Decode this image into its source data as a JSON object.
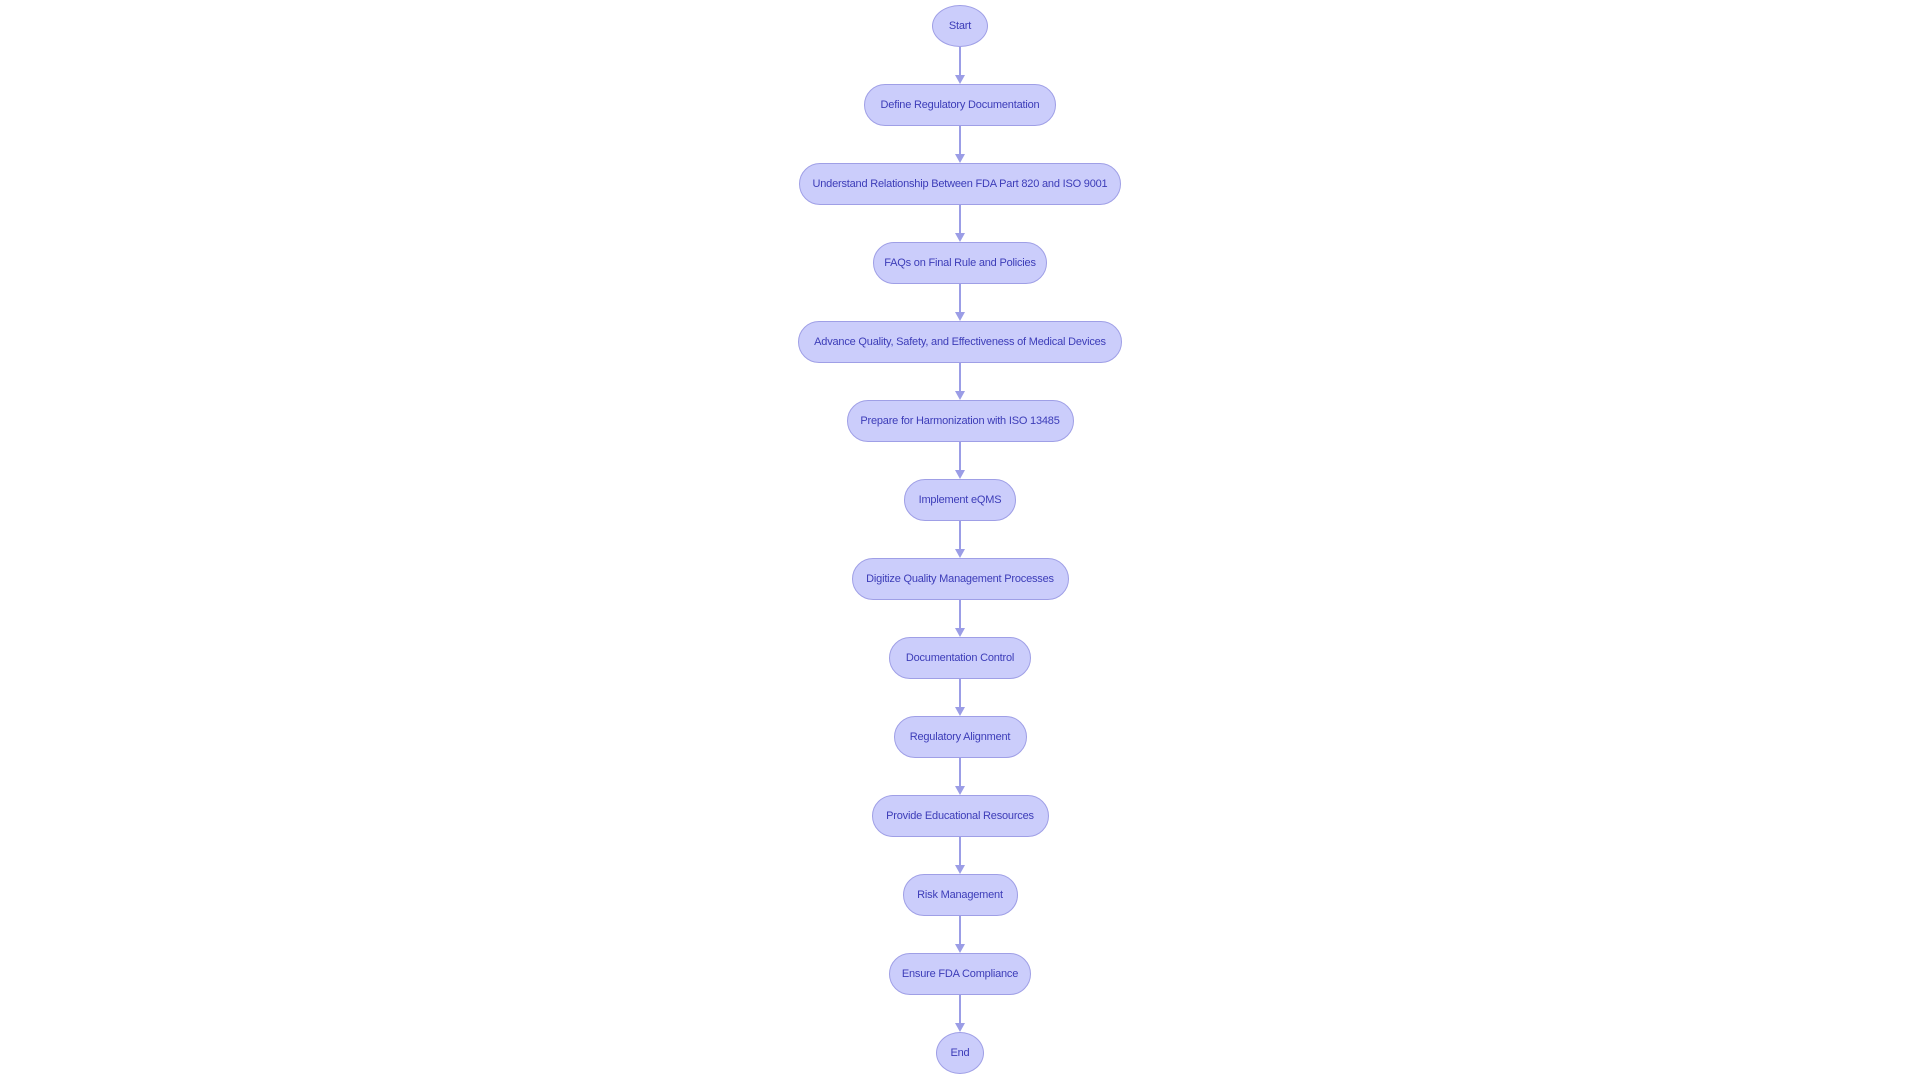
{
  "diagram": {
    "type": "flowchart",
    "direction": "top-to-bottom",
    "colors": {
      "node_fill": "#cbcdfb",
      "node_border": "#9f9fe6",
      "node_text": "#3c3cb8",
      "edge": "#9b9de6",
      "background": "#ffffff"
    },
    "nodes": [
      {
        "id": "start",
        "label": "Start",
        "shape": "circle"
      },
      {
        "id": "define",
        "label": "Define Regulatory Documentation",
        "shape": "stadium"
      },
      {
        "id": "understand",
        "label": "Understand Relationship Between FDA Part 820 and ISO 9001",
        "shape": "stadium"
      },
      {
        "id": "faqs",
        "label": "FAQs on Final Rule and Policies",
        "shape": "stadium"
      },
      {
        "id": "advance",
        "label": "Advance Quality, Safety, and Effectiveness of Medical Devices",
        "shape": "stadium"
      },
      {
        "id": "prepare",
        "label": "Prepare for Harmonization with ISO 13485",
        "shape": "stadium"
      },
      {
        "id": "implement",
        "label": "Implement eQMS",
        "shape": "stadium"
      },
      {
        "id": "digitize",
        "label": "Digitize Quality Management Processes",
        "shape": "stadium"
      },
      {
        "id": "doccontrol",
        "label": "Documentation Control",
        "shape": "stadium"
      },
      {
        "id": "regalign",
        "label": "Regulatory Alignment",
        "shape": "stadium"
      },
      {
        "id": "provide",
        "label": "Provide Educational Resources",
        "shape": "stadium"
      },
      {
        "id": "risk",
        "label": "Risk Management",
        "shape": "stadium"
      },
      {
        "id": "ensure",
        "label": "Ensure FDA Compliance",
        "shape": "stadium"
      },
      {
        "id": "end",
        "label": "End",
        "shape": "circle"
      }
    ],
    "edges": [
      {
        "from": "start",
        "to": "define"
      },
      {
        "from": "define",
        "to": "understand"
      },
      {
        "from": "understand",
        "to": "faqs"
      },
      {
        "from": "faqs",
        "to": "advance"
      },
      {
        "from": "advance",
        "to": "prepare"
      },
      {
        "from": "prepare",
        "to": "implement"
      },
      {
        "from": "implement",
        "to": "digitize"
      },
      {
        "from": "digitize",
        "to": "doccontrol"
      },
      {
        "from": "doccontrol",
        "to": "regalign"
      },
      {
        "from": "regalign",
        "to": "provide"
      },
      {
        "from": "provide",
        "to": "risk"
      },
      {
        "from": "risk",
        "to": "ensure"
      },
      {
        "from": "ensure",
        "to": "end"
      }
    ]
  }
}
